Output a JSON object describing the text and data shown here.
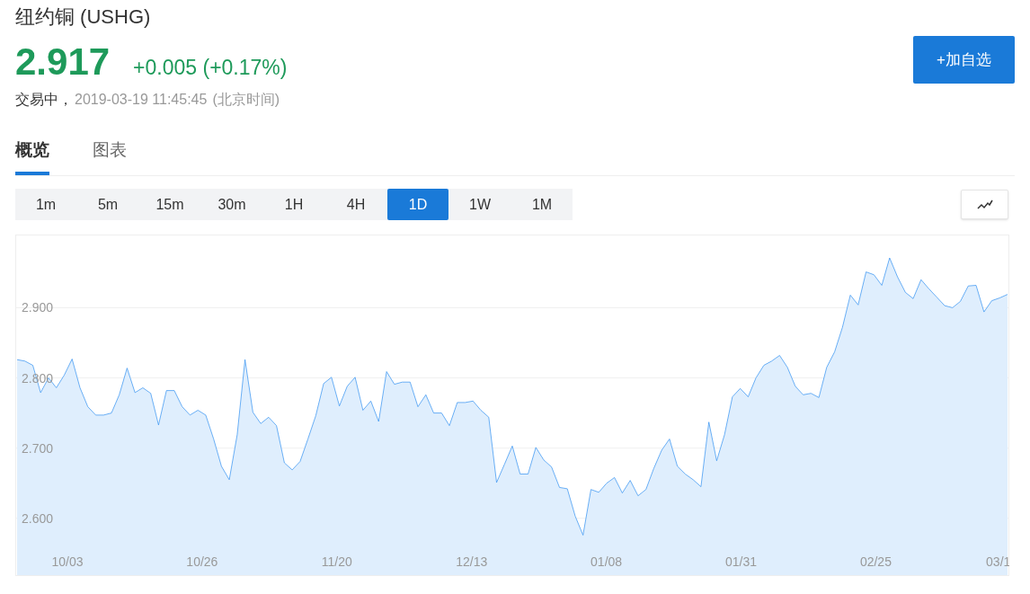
{
  "header": {
    "title": "纽约铜 (USHG)",
    "price": "2.917",
    "change": "+0.005 (+0.17%)",
    "status": "交易中，",
    "timestamp": "2019-03-19 11:45:45",
    "timezone": "(北京时间)"
  },
  "watchlist_button": "+加自选",
  "tabs": [
    {
      "label": "概览",
      "selected": true
    },
    {
      "label": "图表",
      "selected": false
    }
  ],
  "periods": [
    {
      "label": "1m",
      "selected": false
    },
    {
      "label": "5m",
      "selected": false
    },
    {
      "label": "15m",
      "selected": false
    },
    {
      "label": "30m",
      "selected": false
    },
    {
      "label": "1H",
      "selected": false
    },
    {
      "label": "4H",
      "selected": false
    },
    {
      "label": "1D",
      "selected": true
    },
    {
      "label": "1W",
      "selected": false
    },
    {
      "label": "1M",
      "selected": false
    }
  ],
  "chart": {
    "x_axis_labels": [
      "10/03",
      "10/26",
      "11/20",
      "12/13",
      "01/08",
      "01/31",
      "02/25",
      "03/1"
    ],
    "chart_data": {
      "type": "area",
      "grid": true,
      "ylim": [
        2.519,
        3.003
      ],
      "yticks": [
        {
          "value": 2.6,
          "label": "2.600"
        },
        {
          "value": 2.7,
          "label": "2.700"
        },
        {
          "value": 2.8,
          "label": "2.800"
        },
        {
          "value": 2.9,
          "label": "2.900"
        }
      ],
      "series": [
        {
          "color": "#2f8ff0",
          "values": [
            2.826,
            2.824,
            2.818,
            2.779,
            2.8,
            2.786,
            2.804,
            2.827,
            2.786,
            2.759,
            2.747,
            2.747,
            2.75,
            2.776,
            2.814,
            2.779,
            2.786,
            2.778,
            2.733,
            2.782,
            2.782,
            2.759,
            2.747,
            2.754,
            2.747,
            2.713,
            2.674,
            2.655,
            2.719,
            2.826,
            2.751,
            2.735,
            2.744,
            2.732,
            2.679,
            2.669,
            2.681,
            2.713,
            2.746,
            2.792,
            2.801,
            2.76,
            2.788,
            2.801,
            2.754,
            2.767,
            2.738,
            2.809,
            2.791,
            2.794,
            2.794,
            2.759,
            2.776,
            2.75,
            2.75,
            2.732,
            2.765,
            2.765,
            2.767,
            2.754,
            2.744,
            2.651,
            2.677,
            2.703,
            2.663,
            2.663,
            2.701,
            2.683,
            2.673,
            2.644,
            2.642,
            2.603,
            2.576,
            2.641,
            2.637,
            2.65,
            2.658,
            2.636,
            2.654,
            2.632,
            2.641,
            2.671,
            2.697,
            2.713,
            2.674,
            2.663,
            2.655,
            2.645,
            2.737,
            2.682,
            2.719,
            2.773,
            2.785,
            2.773,
            2.8,
            2.818,
            2.824,
            2.832,
            2.815,
            2.788,
            2.776,
            2.778,
            2.772,
            2.815,
            2.837,
            2.872,
            2.918,
            2.904,
            2.951,
            2.947,
            2.932,
            2.971,
            2.944,
            2.922,
            2.913,
            2.94,
            2.927,
            2.915,
            2.903,
            2.9,
            2.909,
            2.931,
            2.932,
            2.894,
            2.91,
            2.914,
            2.919
          ]
        }
      ]
    }
  }
}
